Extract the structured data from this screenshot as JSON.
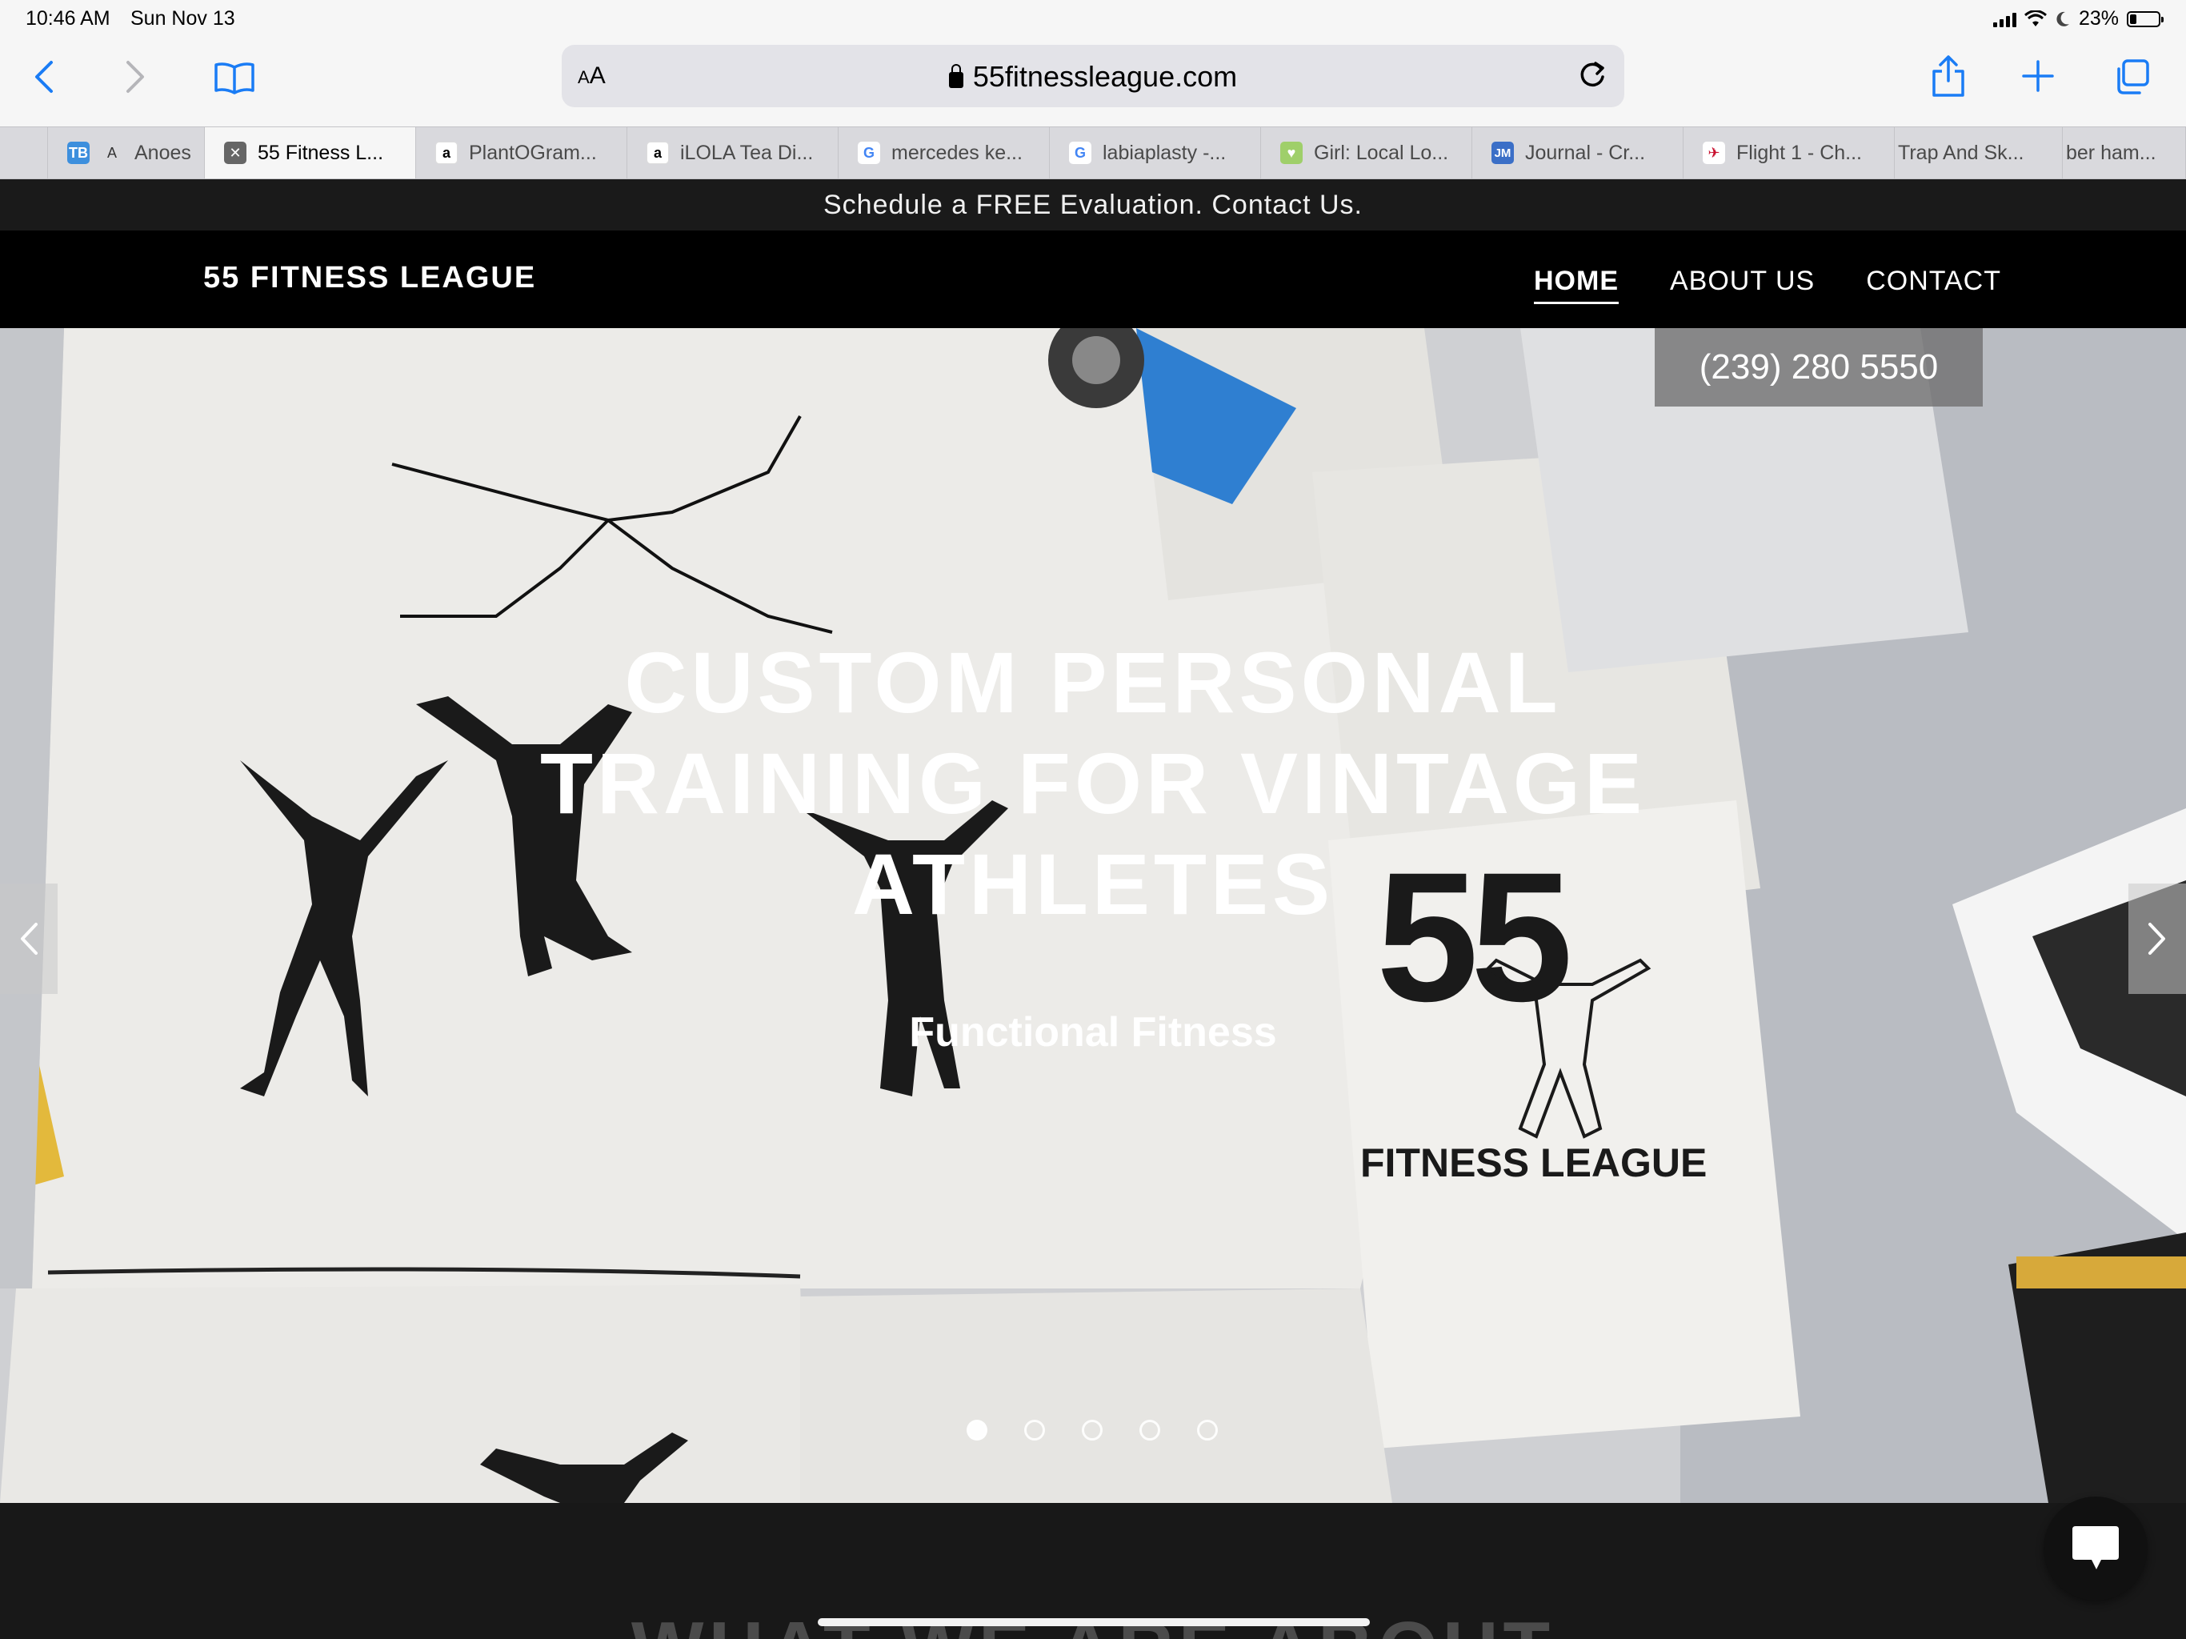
{
  "status_bar": {
    "time": "10:46 AM",
    "date": "Sun Nov 13",
    "battery": "23%",
    "battery_level": 0.23
  },
  "toolbar": {
    "reader_label_small": "A",
    "reader_label_large": "A",
    "url": "55fitnessleague.com"
  },
  "tabs": [
    {
      "label": "",
      "favicon": "TB",
      "favicon_color": "#3d8fdd"
    },
    {
      "label": "Anoes",
      "favicon": "A",
      "favicon_color": "#ffffff"
    },
    {
      "label": "55 Fitness L...",
      "favicon": "✕",
      "favicon_color": "#5a5a5a",
      "active": true
    },
    {
      "label": "PlantOGram...",
      "favicon": "a",
      "favicon_color": "#ffffff"
    },
    {
      "label": "iLOLA Tea Di...",
      "favicon": "a",
      "favicon_color": "#ffffff"
    },
    {
      "label": "mercedes ke...",
      "favicon": "G",
      "favicon_color": "#ffffff"
    },
    {
      "label": "labiaplasty -...",
      "favicon": "G",
      "favicon_color": "#ffffff"
    },
    {
      "label": "Girl: Local Lo...",
      "favicon": "♥",
      "favicon_color": "#ffffff"
    },
    {
      "label": "Journal - Cr...",
      "favicon": "JM",
      "favicon_color": "#3b6fc7"
    },
    {
      "label": "Flight 1 - Ch...",
      "favicon": "✈",
      "favicon_color": "#ffffff"
    },
    {
      "label": "Trap And Sk...",
      "favicon": "",
      "favicon_color": "#ffffff"
    },
    {
      "label": "ber ham...",
      "favicon": "",
      "favicon_color": "#ffffff"
    }
  ],
  "announcement": "Schedule a FREE Evaluation. Contact Us.",
  "header": {
    "brand": "55 FITNESS LEAGUE",
    "nav": [
      {
        "label": "HOME",
        "active": true
      },
      {
        "label": "ABOUT US"
      },
      {
        "label": "CONTACT"
      }
    ]
  },
  "hero": {
    "phone": "(239) 280 5550",
    "title_lines": [
      "CUSTOM PERSONAL",
      "TRAINING FOR VINTAGE",
      "ATHLETES"
    ],
    "subtitle": "Functional Fitness",
    "logo_number": "55",
    "logo_text": "FITNESS LEAGUE",
    "slides": 5,
    "active_slide": 1
  },
  "section": {
    "heading": "WHAT WE ARE ABOUT"
  },
  "colors": {
    "accent": "#1a7cf5",
    "header_bg": "#000000",
    "announce_bg": "#1a1a1a",
    "section_bg": "#181818"
  },
  "icons": [
    "back-icon",
    "forward-icon",
    "bookmarks-icon",
    "lock-icon",
    "reload-icon",
    "share-icon",
    "new-tab-icon",
    "tabs-overview-icon",
    "chevron-left-icon",
    "chevron-right-icon",
    "chat-icon"
  ]
}
